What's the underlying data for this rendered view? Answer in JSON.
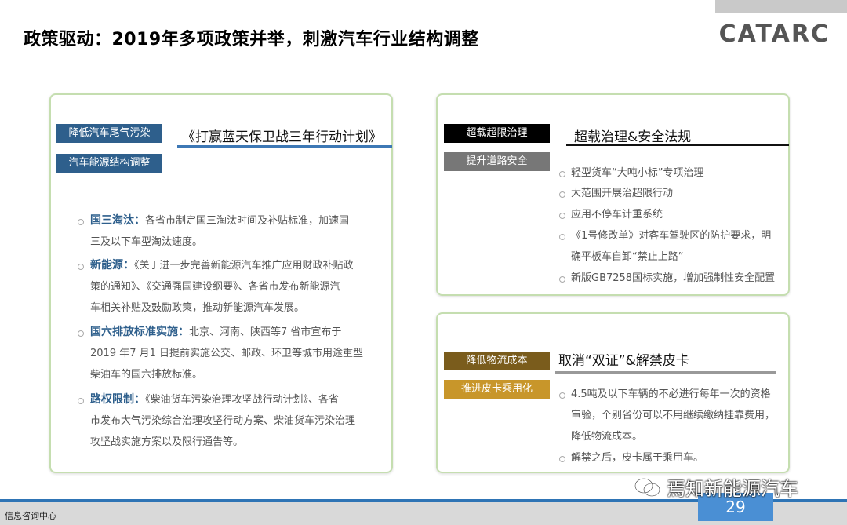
{
  "title": "政策驱动：2019年多项政策并举，刺激汽车行业结构调整",
  "logo": "CATARC",
  "left": {
    "tags": [
      "降低汽车尾气污染",
      "汽车能源结构调整"
    ],
    "headline": "《打赢蓝天保卫战三年行动计划》",
    "items": [
      {
        "key": "国三淘汰：",
        "lines": [
          "各省市制定国三淘汰时间及补贴标准，加速国",
          "三及以下车型淘汰速度。"
        ]
      },
      {
        "key": "新能源：",
        "lines": [
          "《关于进一步完善新能源汽车推广应用财政补贴政",
          "策的通知》、《交通强国建设纲要》、各省市发布新能源汽",
          "车相关补贴及鼓励政策，推动新能源汽车发展。"
        ]
      },
      {
        "key": "国六排放标准实施：",
        "lines": [
          "北京、河南、陕西等7 省市宣布于",
          "2019 年7 月1 日提前实施公交、邮政、环卫等城市用途重型",
          "柴油车的国六排放标准。"
        ]
      },
      {
        "key": "路权限制：",
        "lines": [
          "《柴油货车污染治理攻坚战行动计划》、各省",
          "市发布大气污染综合治理攻坚行动方案、柴油货车污染治理",
          "攻坚战实施方案以及限行通告等。"
        ]
      }
    ]
  },
  "topright": {
    "tags": [
      "超载超限治理",
      "提升道路安全"
    ],
    "headline": "超载治理&安全法规",
    "items": [
      [
        "轻型货车“大吨小标”专项治理"
      ],
      [
        "大范围开展治超限行动"
      ],
      [
        "应用不停车计重系统"
      ],
      [
        "《1号修改单》对客车驾驶区的防护要求，明",
        "确平板车自卸“禁止上路”"
      ],
      [
        "新版GB7258国标实施，增加强制性安全配置"
      ]
    ]
  },
  "bottomright": {
    "tags": [
      "降低物流成本",
      "推进皮卡乘用化"
    ],
    "headline": "取消“双证”&解禁皮卡",
    "items": [
      [
        "4.5吨及以下车辆的不必进行每年一次的资格",
        "审验，个别省份可以不用继续缴纳挂靠费用，",
        "降低物流成本。"
      ],
      [
        "解禁之后，皮卡属于乘用车。"
      ]
    ]
  },
  "footer": {
    "label": "信息咨询中心",
    "page": "29",
    "watermark": "焉知新能源汽车"
  },
  "colors": {
    "blue": "#2e5f8c",
    "green_border": "#c5deb0",
    "page_blue": "#4a8fd4"
  }
}
